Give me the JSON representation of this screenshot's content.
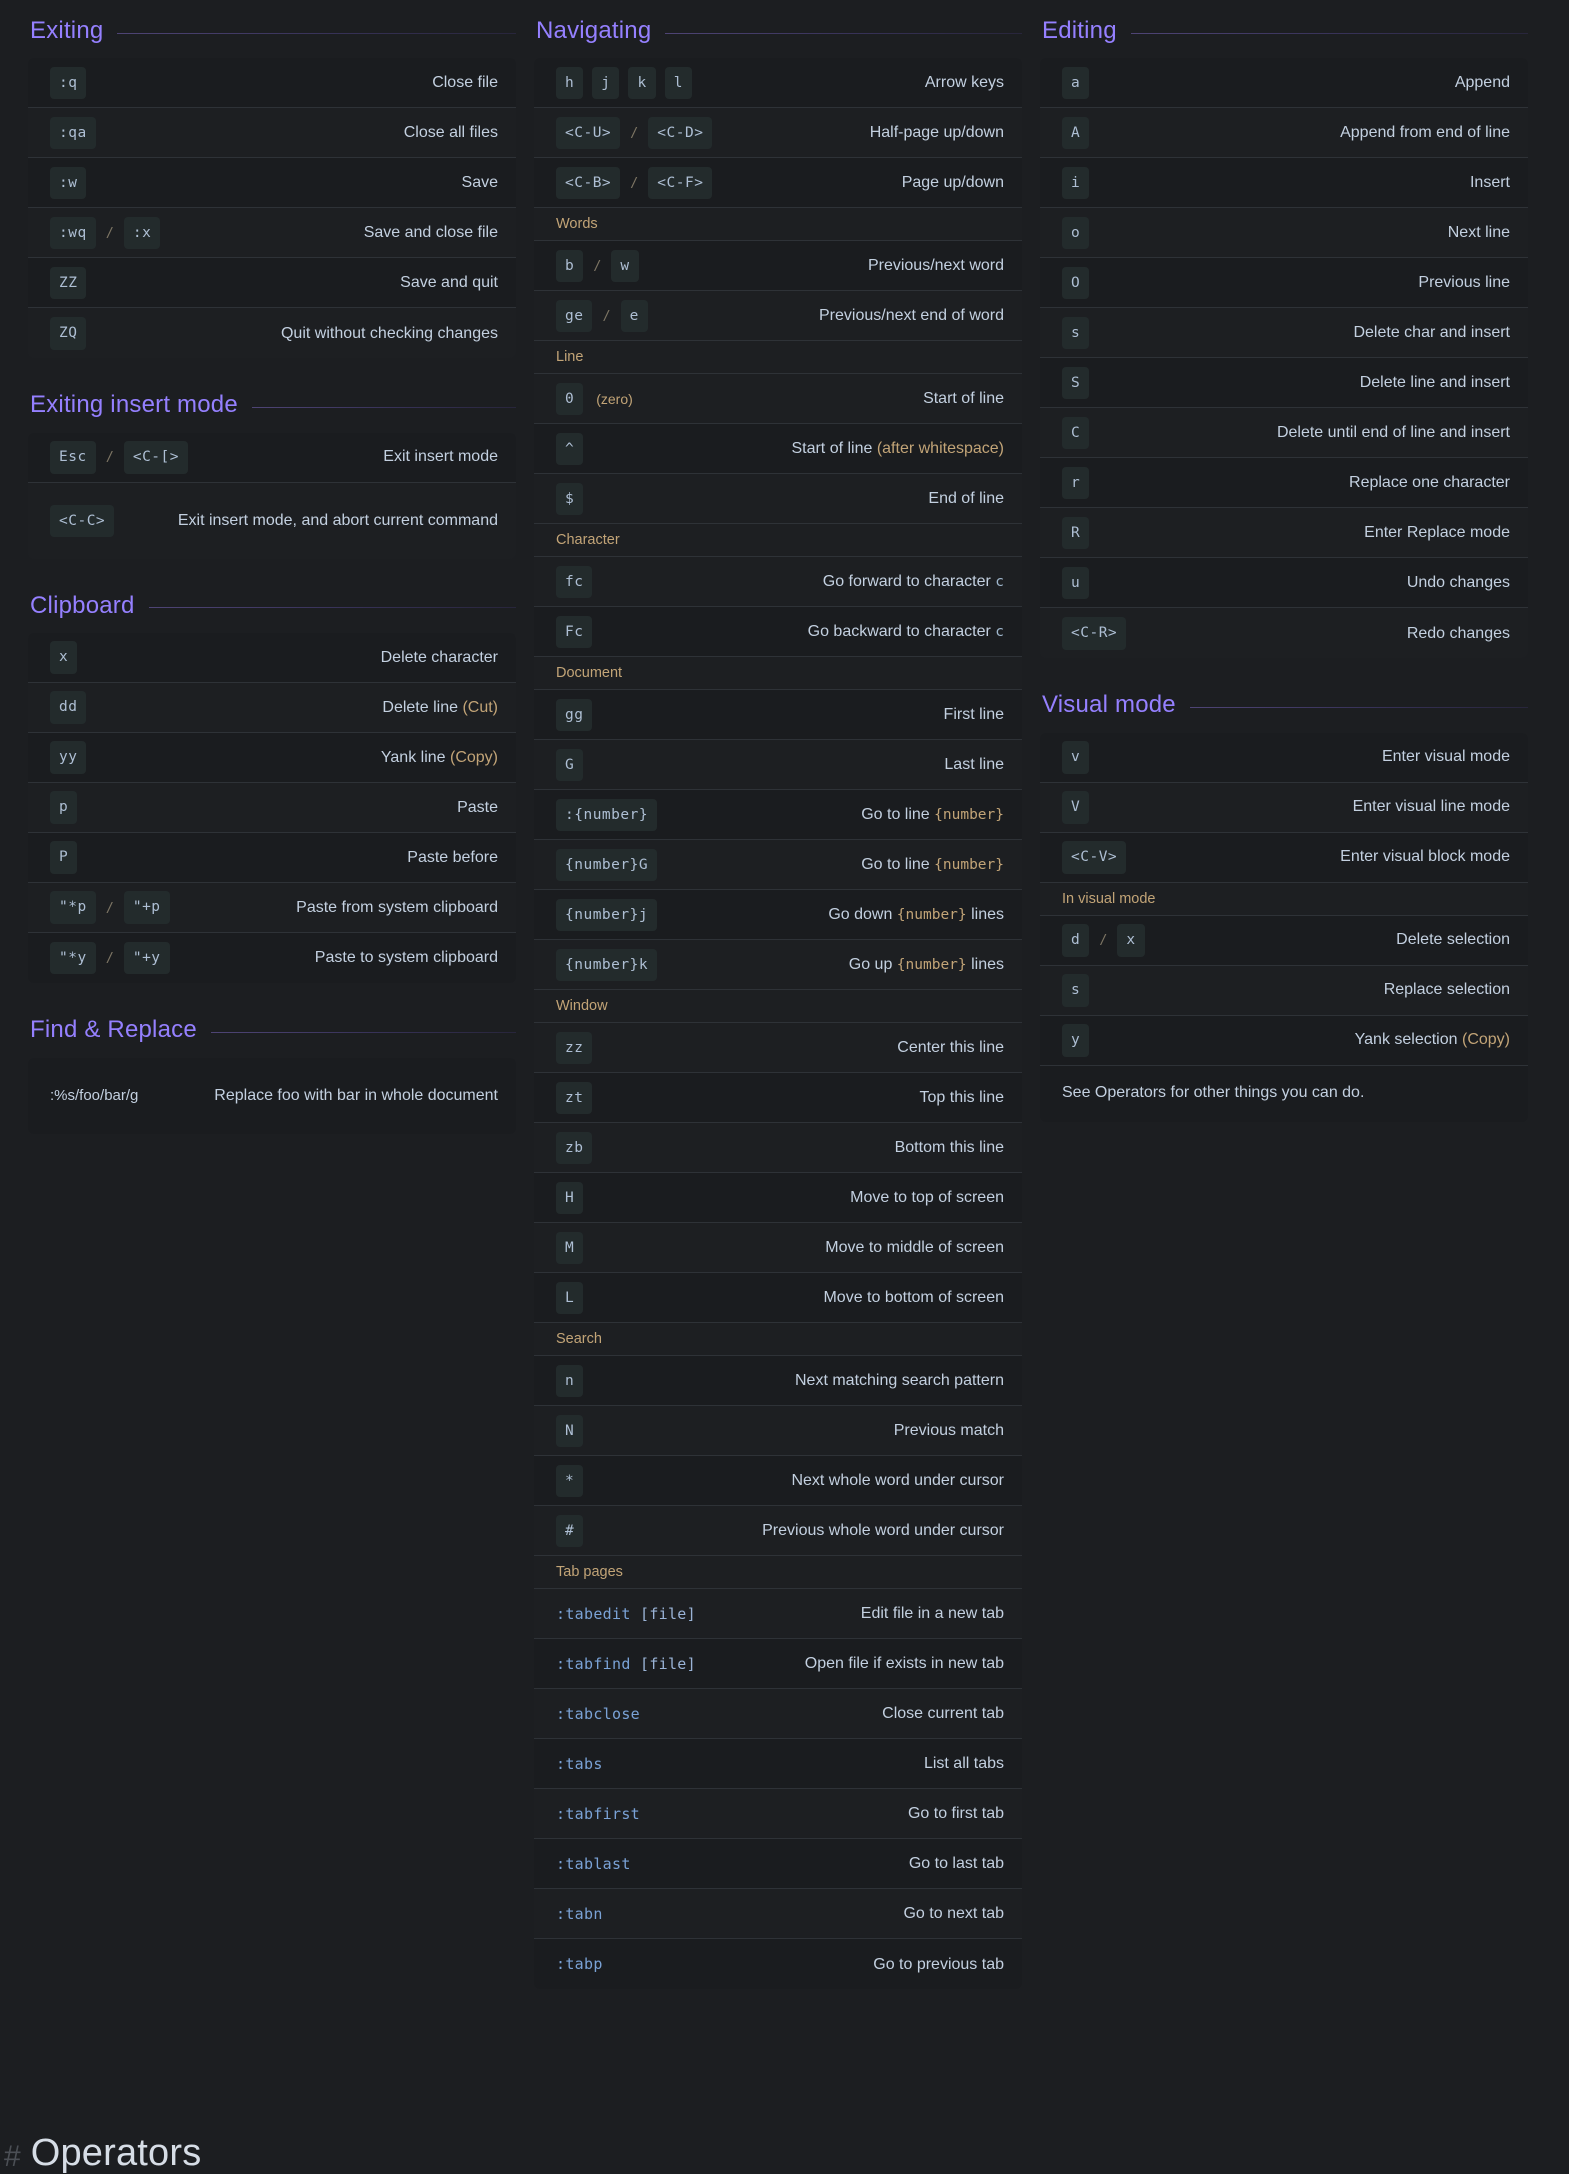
{
  "meta": {
    "accent_color": "#9580ff",
    "background_color": "#1c1e21",
    "key_text_color": "#aebfd4",
    "annotation_color": "#c2a477",
    "code_color": "#7aa2d6"
  },
  "bottom_heading": {
    "hash": "#",
    "title": "Operators"
  },
  "columns": [
    {
      "id": "column-left",
      "sections": [
        {
          "id": "exiting",
          "title": "Exiting",
          "rows": [
            {
              "keys": [
                ":q"
              ],
              "desc": "Close file"
            },
            {
              "keys": [
                ":qa"
              ],
              "desc": "Close all files"
            },
            {
              "keys": [
                ":w"
              ],
              "desc": "Save"
            },
            {
              "keys": [
                ":wq",
                ":x"
              ],
              "sep": "/",
              "desc": "Save and close file"
            },
            {
              "keys": [
                "ZZ"
              ],
              "desc": "Save and quit"
            },
            {
              "keys": [
                "ZQ"
              ],
              "desc": "Quit without checking changes"
            }
          ]
        },
        {
          "id": "exiting-insert-mode",
          "title": "Exiting insert mode",
          "rows": [
            {
              "keys": [
                "Esc",
                "<C-[>"
              ],
              "sep": "/",
              "desc": "Exit insert mode"
            },
            {
              "keys": [
                "<C-C>"
              ],
              "desc": "Exit insert mode, and abort current command",
              "tall": true
            }
          ]
        },
        {
          "id": "clipboard",
          "title": "Clipboard",
          "rows": [
            {
              "keys": [
                "x"
              ],
              "desc": "Delete character"
            },
            {
              "keys": [
                "dd"
              ],
              "desc": "Delete line ",
              "desc_amber": "(Cut)"
            },
            {
              "keys": [
                "yy"
              ],
              "desc": "Yank line ",
              "desc_amber": "(Copy)"
            },
            {
              "keys": [
                "p"
              ],
              "desc": "Paste"
            },
            {
              "keys": [
                "P"
              ],
              "desc": "Paste before"
            },
            {
              "keys": [
                "\"*p",
                "\"+p"
              ],
              "sep": "/",
              "desc": "Paste from system clipboard"
            },
            {
              "keys": [
                "\"*y",
                "\"+y"
              ],
              "sep": "/",
              "desc": "Paste to system clipboard"
            }
          ]
        },
        {
          "id": "find-and-replace",
          "title": "Find & Replace",
          "rows": [
            {
              "plain": ":%s/foo/bar/g",
              "plain_style": "text",
              "desc": "Replace foo with bar in whole document",
              "tall": true
            }
          ]
        }
      ]
    },
    {
      "id": "column-middle",
      "sections": [
        {
          "id": "navigating",
          "title": "Navigating",
          "rows": [
            {
              "keys": [
                "h",
                "j",
                "k",
                "l"
              ],
              "desc": "Arrow keys"
            },
            {
              "keys": [
                "<C-U>",
                "<C-D>"
              ],
              "sep": "/",
              "desc": "Half-page up/down"
            },
            {
              "keys": [
                "<C-B>",
                "<C-F>"
              ],
              "sep": "/",
              "desc": "Page up/down"
            },
            {
              "subhead": "Words"
            },
            {
              "keys": [
                "b",
                "w"
              ],
              "sep": "/",
              "desc": "Previous/next word"
            },
            {
              "keys": [
                "ge",
                "e"
              ],
              "sep": "/",
              "desc": "Previous/next end of word"
            },
            {
              "subhead": "Line"
            },
            {
              "keys": [
                "0"
              ],
              "note": "(zero)",
              "desc": "Start of line"
            },
            {
              "keys": [
                "^"
              ],
              "desc": "Start of line ",
              "desc_amber": "(after whitespace)"
            },
            {
              "keys": [
                "$"
              ],
              "desc": "End of line"
            },
            {
              "subhead": "Character"
            },
            {
              "keys": [
                "fc"
              ],
              "desc": "Go forward to character ",
              "desc_mono_c": "c"
            },
            {
              "keys": [
                "Fc"
              ],
              "desc": "Go backward to character ",
              "desc_mono_c": "c"
            },
            {
              "subhead": "Document"
            },
            {
              "keys": [
                "gg"
              ],
              "desc": "First line"
            },
            {
              "keys": [
                "G"
              ],
              "desc": "Last line"
            },
            {
              "keys": [
                ":{number}"
              ],
              "desc": "Go to line ",
              "desc_mono": "{number}"
            },
            {
              "keys": [
                "{number}G"
              ],
              "desc": "Go to line ",
              "desc_mono": "{number}"
            },
            {
              "keys": [
                "{number}j"
              ],
              "desc": "Go down ",
              "desc_mono": "{number}",
              "desc_tail": " lines"
            },
            {
              "keys": [
                "{number}k"
              ],
              "desc": "Go up ",
              "desc_mono": "{number}",
              "desc_tail": " lines"
            },
            {
              "subhead": "Window"
            },
            {
              "keys": [
                "zz"
              ],
              "desc": "Center this line"
            },
            {
              "keys": [
                "zt"
              ],
              "desc": "Top this line"
            },
            {
              "keys": [
                "zb"
              ],
              "desc": "Bottom this line"
            },
            {
              "keys": [
                "H"
              ],
              "desc": "Move to top of screen"
            },
            {
              "keys": [
                "M"
              ],
              "desc": "Move to middle of screen"
            },
            {
              "keys": [
                "L"
              ],
              "desc": "Move to bottom of screen"
            },
            {
              "subhead": "Search"
            },
            {
              "keys": [
                "n"
              ],
              "desc": "Next matching search pattern"
            },
            {
              "keys": [
                "N"
              ],
              "desc": "Previous match"
            },
            {
              "keys": [
                "*"
              ],
              "desc": "Next whole word under cursor"
            },
            {
              "keys": [
                "#"
              ],
              "desc": "Previous whole word under cursor"
            },
            {
              "subhead": "Tab pages"
            },
            {
              "plain": ":tabedit",
              "plain_dim": " [file]",
              "plain_style": "code",
              "desc": "Edit file in a new tab"
            },
            {
              "plain": ":tabfind",
              "plain_dim": " [file]",
              "plain_style": "code",
              "desc": "Open file if exists in new tab"
            },
            {
              "plain": ":tabclose",
              "plain_style": "code",
              "desc": "Close current tab"
            },
            {
              "plain": ":tabs",
              "plain_style": "code",
              "desc": "List all tabs"
            },
            {
              "plain": ":tabfirst",
              "plain_style": "code",
              "desc": "Go to first tab"
            },
            {
              "plain": ":tablast",
              "plain_style": "code",
              "desc": "Go to last tab"
            },
            {
              "plain": ":tabn",
              "plain_style": "code",
              "desc": "Go to next tab"
            },
            {
              "plain": ":tabp",
              "plain_style": "code",
              "desc": "Go to previous tab"
            }
          ]
        }
      ]
    },
    {
      "id": "column-right",
      "sections": [
        {
          "id": "editing",
          "title": "Editing",
          "rows": [
            {
              "keys": [
                "a"
              ],
              "desc": "Append"
            },
            {
              "keys": [
                "A"
              ],
              "desc": "Append from end of line"
            },
            {
              "keys": [
                "i"
              ],
              "desc": "Insert"
            },
            {
              "keys": [
                "o"
              ],
              "desc": "Next line"
            },
            {
              "keys": [
                "O"
              ],
              "desc": "Previous line"
            },
            {
              "keys": [
                "s"
              ],
              "desc": "Delete char and insert"
            },
            {
              "keys": [
                "S"
              ],
              "desc": "Delete line and insert"
            },
            {
              "keys": [
                "C"
              ],
              "desc": "Delete until end of line and insert"
            },
            {
              "keys": [
                "r"
              ],
              "desc": "Replace one character"
            },
            {
              "keys": [
                "R"
              ],
              "desc": "Enter Replace mode"
            },
            {
              "keys": [
                "u"
              ],
              "desc": "Undo changes"
            },
            {
              "keys": [
                "<C-R>"
              ],
              "desc": "Redo changes"
            }
          ]
        },
        {
          "id": "visual-mode",
          "title": "Visual mode",
          "rows": [
            {
              "keys": [
                "v"
              ],
              "desc": "Enter visual mode"
            },
            {
              "keys": [
                "V"
              ],
              "desc": "Enter visual line mode"
            },
            {
              "keys": [
                "<C-V>"
              ],
              "desc": "Enter visual block mode"
            },
            {
              "subhead": "In visual mode"
            },
            {
              "keys": [
                "d",
                "x"
              ],
              "sep": "/",
              "desc": "Delete selection"
            },
            {
              "keys": [
                "s"
              ],
              "desc": "Replace selection"
            },
            {
              "keys": [
                "y"
              ],
              "desc": "Yank selection ",
              "desc_amber": "(Copy)"
            },
            {
              "footnote": "See Operators for other things you can do."
            }
          ]
        }
      ]
    }
  ]
}
